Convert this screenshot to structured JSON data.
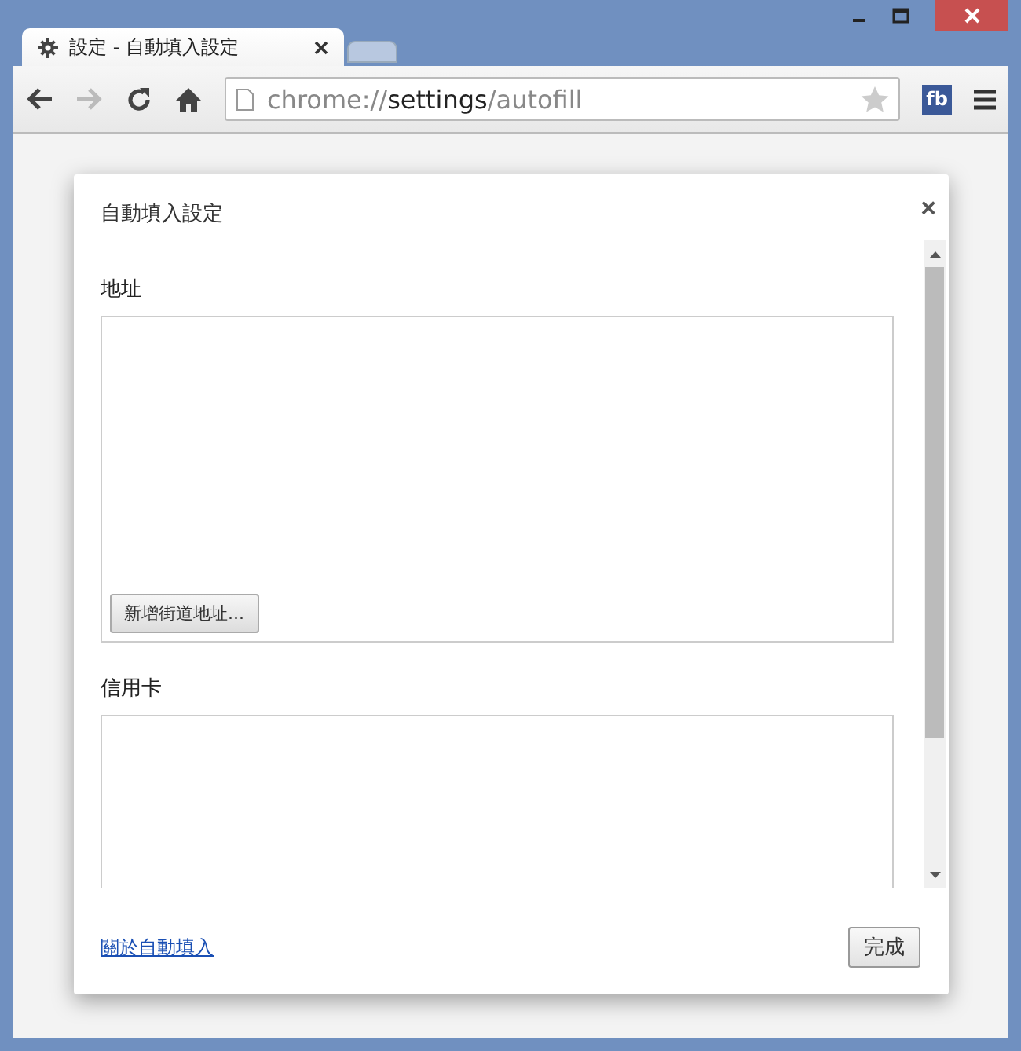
{
  "browser": {
    "tabs": [
      {
        "title": "設定 - 自動填入設定",
        "selected": true
      },
      {
        "selected": false
      }
    ],
    "url": {
      "scheme": "chrome://",
      "host": "settings",
      "path": "/autofill"
    },
    "extension": "fb"
  },
  "dialog": {
    "title": "自動填入設定",
    "close": "×",
    "sections": [
      {
        "heading": "地址",
        "button": "新增街道地址..."
      },
      {
        "heading": "信用卡"
      }
    ],
    "link": "關於自動填入",
    "done": "完成"
  }
}
